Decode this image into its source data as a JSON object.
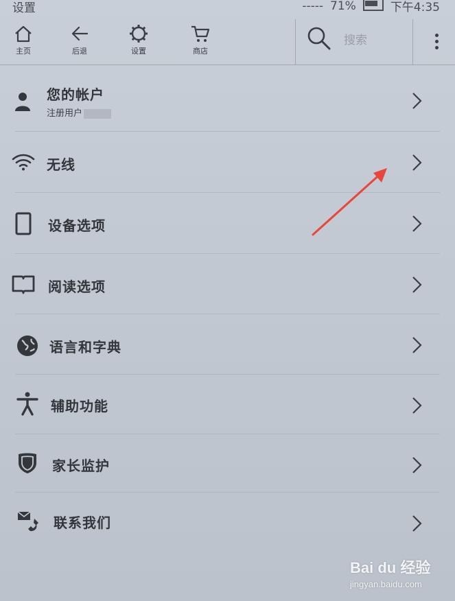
{
  "statusbar": {
    "title": "设置",
    "signal": "-----",
    "battery": "71%",
    "time": "下午4:35"
  },
  "toolbar": {
    "home_label": "主页",
    "back_label": "后退",
    "settings_label": "设置",
    "store_label": "商店",
    "search_placeholder": "搜索"
  },
  "settings": {
    "items": [
      {
        "label": "您的帐户",
        "sublabel": "注册用户",
        "icon": "user-icon"
      },
      {
        "label": "无线",
        "icon": "wifi-icon"
      },
      {
        "label": "设备选项",
        "icon": "device-icon"
      },
      {
        "label": "阅读选项",
        "icon": "book-icon"
      },
      {
        "label": "语言和字典",
        "icon": "globe-icon"
      },
      {
        "label": "辅助功能",
        "icon": "accessibility-icon"
      },
      {
        "label": "家长监护",
        "icon": "shield-icon"
      },
      {
        "label": "联系我们",
        "icon": "contact-icon"
      }
    ]
  },
  "watermark": {
    "brand": "Bai du 经验",
    "url": "jingyan.baidu.com"
  },
  "colors": {
    "annotation_arrow": "#e8453c",
    "background": "#c6ccd5"
  }
}
